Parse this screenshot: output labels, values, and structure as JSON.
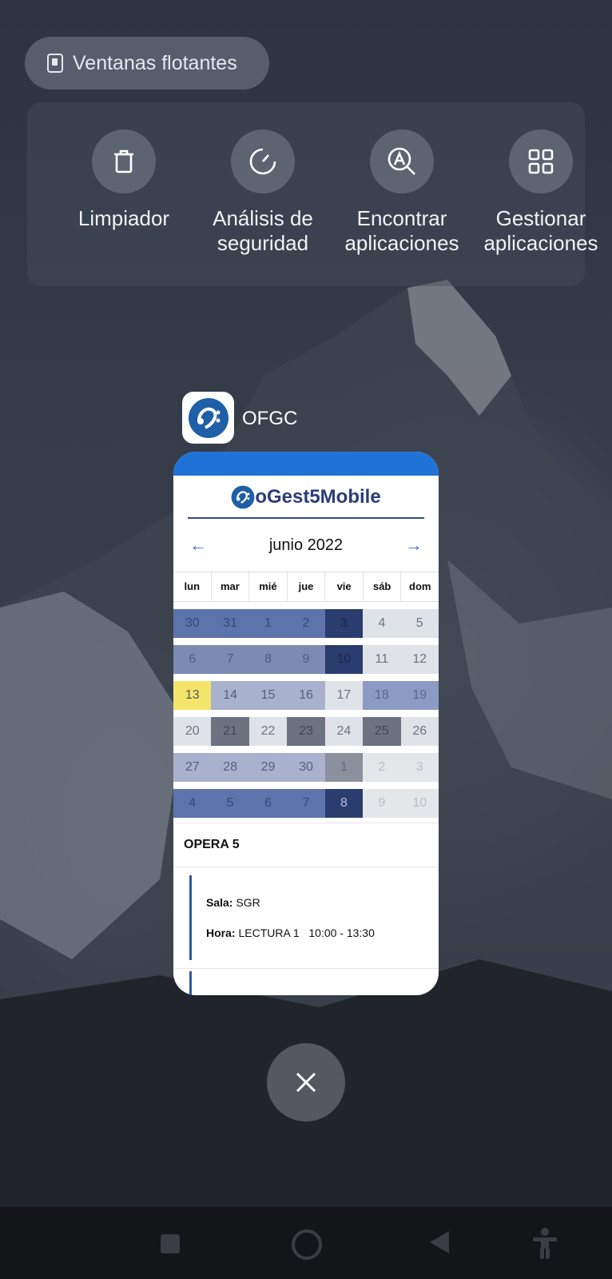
{
  "floating_windows": {
    "label": "Ventanas flotantes",
    "icon": "floating-window-icon"
  },
  "quick_tools": [
    {
      "label": "Limpiador",
      "icon": "trash-icon"
    },
    {
      "label": "Análisis de seguridad",
      "line1": "Análisis de",
      "line2": "seguridad",
      "icon": "gauge-icon"
    },
    {
      "label": "Encontrar aplicaciones",
      "line1": "Encontrar",
      "line2": "aplicaciones",
      "icon": "app-search-icon"
    },
    {
      "label": "Gestionar aplicaciones",
      "line1": "Gestionar",
      "line2": "aplicaciones",
      "icon": "grid-icon"
    }
  ],
  "recent_app": {
    "name": "OFGC",
    "brand": "oGest5Mobile",
    "month": "junio 2022",
    "weekdays": [
      "lun",
      "mar",
      "mié",
      "jue",
      "vie",
      "sáb",
      "dom"
    ],
    "weeks": [
      [
        "30",
        "31",
        "1",
        "2",
        "3",
        "4",
        "5"
      ],
      [
        "6",
        "7",
        "8",
        "9",
        "10",
        "11",
        "12"
      ],
      [
        "13",
        "14",
        "15",
        "16",
        "17",
        "18",
        "19"
      ],
      [
        "20",
        "21",
        "22",
        "23",
        "24",
        "25",
        "26"
      ],
      [
        "27",
        "28",
        "29",
        "30",
        "1",
        "2",
        "3"
      ],
      [
        "4",
        "5",
        "6",
        "7",
        "8",
        "9",
        "10"
      ]
    ],
    "event_group": "OPERA 5",
    "event": {
      "sala_label": "Sala:",
      "sala_value": "SGR",
      "hora_label": "Hora:",
      "hora_value": "LECTURA 1   10:00 - 13:30"
    }
  },
  "colors": {
    "accent": "#1f72d6",
    "today": "#f3e56b",
    "brand_text": "#2a3d78"
  }
}
